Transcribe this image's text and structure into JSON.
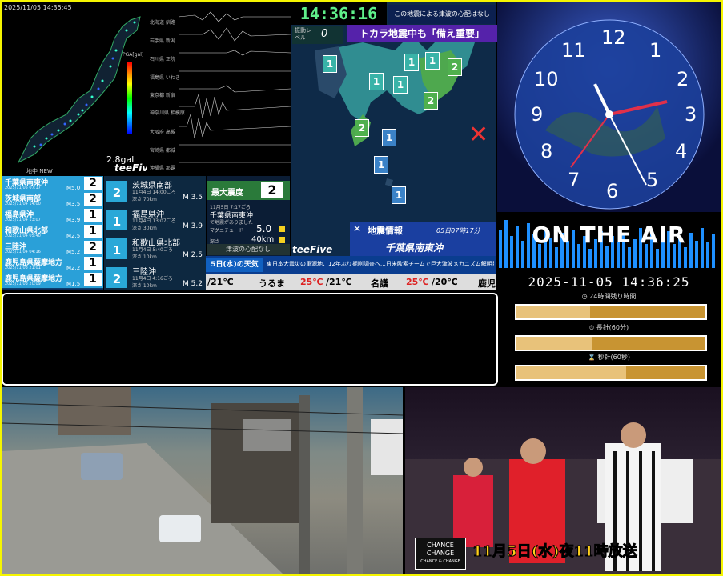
{
  "map_panel": {
    "timestamp": "2025/11/05 14:35:45",
    "gal": "2.8gal",
    "brand": "teeFive",
    "pga_label": "PGA[gal]",
    "legend_note": "地中 NEW"
  },
  "waveforms": {
    "stations": [
      "北海道 釧路",
      "岩手県 新潟",
      "石川県 正院",
      "福島県 いわき",
      "東京都 新宿",
      "神奈川県 相模原",
      "大阪府 高槻",
      "宮崎県 都城",
      "沖縄県 那覇"
    ]
  },
  "quake_list": [
    {
      "place": "千葉県南東沖",
      "date": "2025/11/05 07:17",
      "mag": "M5.0",
      "intensity": "2"
    },
    {
      "place": "茨城県南部",
      "date": "2025/11/04 14:00",
      "mag": "M3.5",
      "intensity": "2"
    },
    {
      "place": "福島県沖",
      "date": "2025/11/04 13:07",
      "mag": "M3.9",
      "intensity": "1"
    },
    {
      "place": "和歌山県北部",
      "date": "2025/11/04 05:40",
      "mag": "M2.5",
      "intensity": "1"
    },
    {
      "place": "三陸沖",
      "date": "2025/11/04 04:16",
      "mag": "M5.2",
      "intensity": "2"
    },
    {
      "place": "鹿児島県薩摩地方",
      "date": "2025/11/03 21:01",
      "mag": "M2.2",
      "intensity": "1"
    },
    {
      "place": "鹿児島県薩摩地方",
      "date": "2025/11/03 20:09",
      "mag": "M1.5",
      "intensity": "1"
    }
  ],
  "mid_list": [
    {
      "place": "茨城県南部",
      "time": "11月4日 14:00ごろ",
      "depth": "深さ 70km",
      "mag": "M 3.5",
      "intensity": "2"
    },
    {
      "place": "福島県沖",
      "time": "11月4日 13:07ごろ",
      "depth": "深さ 30km",
      "mag": "M 3.9",
      "intensity": "1"
    },
    {
      "place": "和歌山県北部",
      "time": "11月4日 5:40ごろ",
      "depth": "深さ 10km",
      "mag": "M 2.5",
      "intensity": "1"
    },
    {
      "place": "三陸沖",
      "time": "11月4日 4:16ごろ",
      "depth": "深さ 10km",
      "mag": "M 5.2",
      "intensity": "2"
    }
  ],
  "info_box": {
    "title": "最大震度",
    "intensity": "2",
    "time": "11月5日 7:17ごろ",
    "place": "千葉県南東沖",
    "note": "で地震がありました",
    "mag_label": "マグニチュード",
    "mag": "5.0",
    "depth_label": "深さ",
    "depth": "40km",
    "tsunami": "津波の心配なし"
  },
  "center": {
    "clock": "14:36:16",
    "tsunami_note": "この地震による津波の心配はなし",
    "headline": "トカラ地震中も「備え重要」",
    "level_label": "振動レベル",
    "level": "0",
    "quake_info_title": "地震情報",
    "quake_info_time": "05日07時17分",
    "quake_info_place": "千葉県南東沖",
    "brand": "teeFive"
  },
  "weather": {
    "label": "5日(水)の天気",
    "news": "東日本大震災の重源地、12年ぶり掘削調査へ…日米欧素チームで巨大津波メカニズム解明目指す",
    "row": [
      {
        "city": "",
        "high": "",
        "low": "/21℃"
      },
      {
        "city": "うるま",
        "high": "25℃",
        "low": "/21℃"
      },
      {
        "city": "名護",
        "high": "25℃",
        "low": "/20℃"
      },
      {
        "city": "鹿児",
        "high": "",
        "low": ""
      }
    ]
  },
  "clock_panel": {
    "numbers": [
      "12",
      "1",
      "2",
      "3",
      "4",
      "5",
      "6",
      "7",
      "8",
      "9",
      "10",
      "11"
    ],
    "on_air": "ON THE AIR",
    "datetime": "2025-11-05 14:36:25",
    "bars": [
      {
        "label": "24時間残り時間",
        "value": 0.39
      },
      {
        "label": "長針(60分)",
        "value": 0.4
      },
      {
        "label": "秒針(60秒)",
        "value": 0.58
      }
    ]
  },
  "promo": {
    "logo_top": "CHANCE",
    "logo_mid": "CHANGE",
    "logo_bot": "CHANCE & CHANGE",
    "text": "11月5日(水)夜11時放送"
  },
  "colors": {
    "frame": "#f5f500",
    "quake_row": "#2aa0d8",
    "headline": "#5522aa",
    "digital_clock": "#5ff08a"
  }
}
